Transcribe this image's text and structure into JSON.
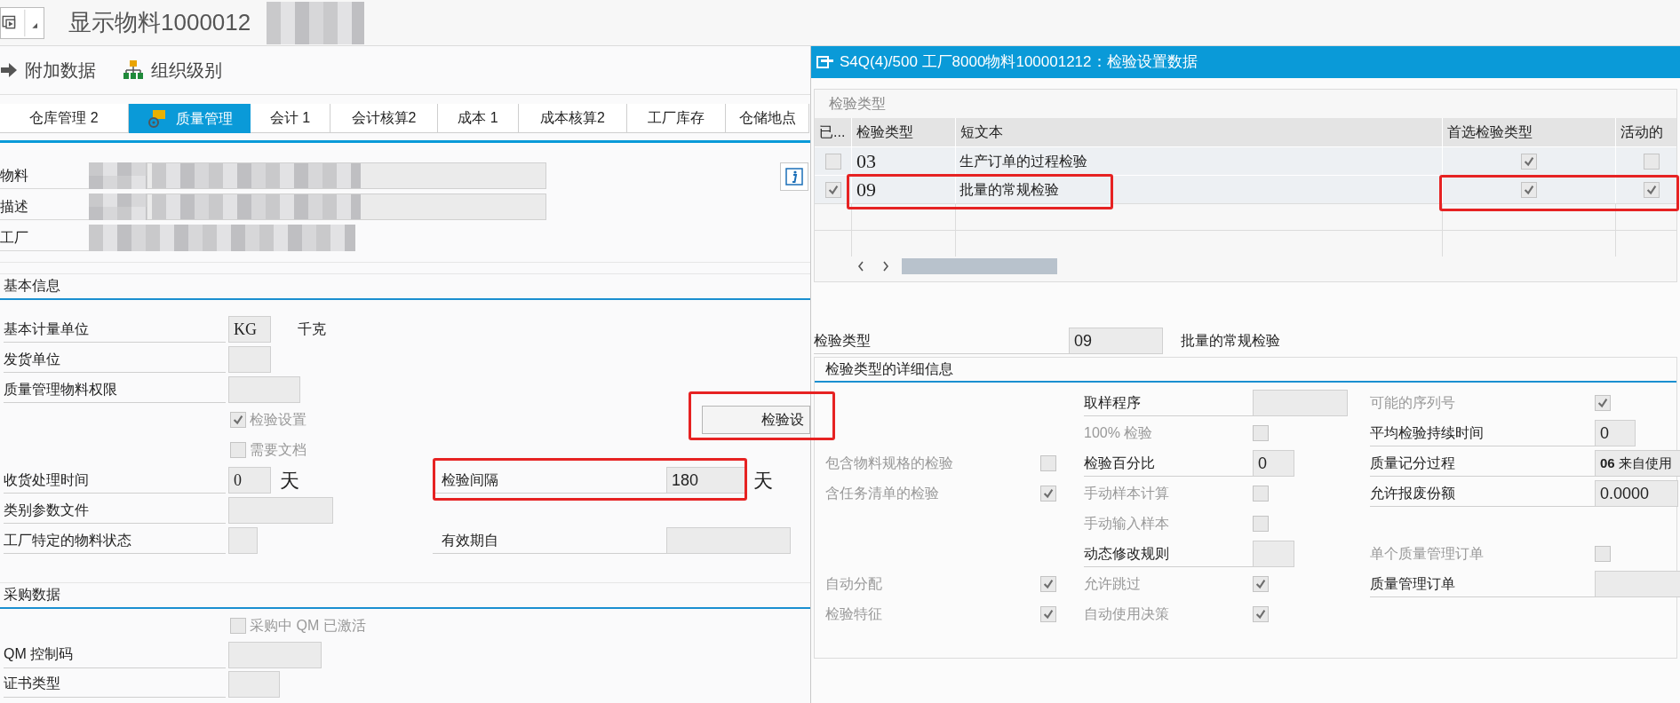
{
  "title_bar": {
    "title": "显示物料1000012"
  },
  "toolbar": [
    "附加数据",
    "组织级别"
  ],
  "tabs": [
    {
      "label": "仓库管理 2",
      "selected": false
    },
    {
      "label": "质量管理",
      "selected": true
    },
    {
      "label": "会计 1",
      "selected": false
    },
    {
      "label": "会计核算2",
      "selected": false
    },
    {
      "label": "成本 1",
      "selected": false
    },
    {
      "label": "成本核算2",
      "selected": false
    },
    {
      "label": "工厂库存",
      "selected": false
    },
    {
      "label": "仓储地点",
      "selected": false
    }
  ],
  "header_fields": [
    {
      "label": "物料"
    },
    {
      "label": "描述"
    },
    {
      "label": "工厂"
    }
  ],
  "basic_info": {
    "title": "基本信息",
    "rows": [
      {
        "kind": "field",
        "label": "基本计量单位",
        "value": "KG",
        "unit": "千克"
      },
      {
        "kind": "field",
        "label": "发货单位"
      },
      {
        "kind": "field",
        "label": "质量管理物料权限"
      },
      {
        "kind": "checkbox",
        "label": "检验设置",
        "checked": true,
        "button": "检验设"
      },
      {
        "kind": "checkbox",
        "label": "需要文档",
        "checked": false
      },
      {
        "kind": "field",
        "label": "收货处理时间",
        "value": "0",
        "unit": "天",
        "right": {
          "label": "检验间隔",
          "value": "180",
          "unit": "天"
        }
      },
      {
        "kind": "field",
        "label": "类别参数文件"
      },
      {
        "kind": "field",
        "label": "工厂特定的物料状态",
        "right": {
          "label": "有效期自"
        }
      }
    ]
  },
  "purchasing": {
    "title": "采购数据",
    "rows": [
      {
        "kind": "checkbox",
        "label": "采购中 QM 已激活",
        "checked": false
      },
      {
        "kind": "field",
        "label": "QM 控制码"
      },
      {
        "kind": "field",
        "label": "证书类型"
      }
    ]
  },
  "dialog": {
    "title": "S4Q(4)/500 工厂8000物料100001212：检验设置数据",
    "group_title": "检验类型",
    "table": {
      "columns": [
        "已...",
        "检验类型",
        "短文本",
        "首选检验类型",
        "活动的"
      ],
      "rows": [
        {
          "column_1_checked": false,
          "type": "03",
          "text": "生产订单的过程检验",
          "preferred": true,
          "active": false
        },
        {
          "column_1_checked": true,
          "type": "09",
          "text": "批量的常规检验",
          "preferred": true,
          "active": true
        }
      ]
    },
    "type_field": {
      "label": "检验类型",
      "value": "09",
      "text": "批量的常规检验"
    },
    "details_title": "检验类型的详细信息",
    "details": [
      {
        "column_2": {
          "kind": "field",
          "label": "取样程序"
        },
        "column_3": {
          "kind": "checkbox",
          "label": "可能的序列号",
          "checked": true
        }
      },
      {
        "column_2": {
          "kind": "checkbox",
          "label": "100% 检验",
          "checked": false
        },
        "column_3": {
          "kind": "field",
          "label": "平均检验持续时间",
          "value": "0"
        }
      },
      {
        "column_1": {
          "kind": "checkbox",
          "label": "包含物料规格的检验",
          "checked": false
        },
        "column_2": {
          "kind": "field",
          "label": "检验百分比",
          "value": "0"
        },
        "column_3": {
          "kind": "field",
          "label": "质量记分过程",
          "value": "**06** 来自使用"
        }
      },
      {
        "column_1": {
          "kind": "checkbox",
          "label": "含任务清单的检验",
          "checked": true
        },
        "column_2": {
          "kind": "checkbox",
          "label": "手动样本计算",
          "checked": false
        },
        "column_3": {
          "kind": "field",
          "label": "允许报废份额",
          "value": "0.0000"
        }
      },
      {
        "column_2": {
          "kind": "checkbox",
          "label": "手动输入样本",
          "checked": false
        }
      },
      {
        "column_2": {
          "kind": "field",
          "label": "动态修改规则"
        },
        "column_3": {
          "kind": "checkbox",
          "label": "单个质量管理订单",
          "checked": false
        }
      },
      {
        "column_1": {
          "kind": "checkbox",
          "label": "自动分配",
          "checked": true
        },
        "column_2": {
          "kind": "checkbox",
          "label": "允许跳过",
          "checked": true
        },
        "column_3": {
          "kind": "field",
          "label": "质量管理订单"
        }
      },
      {
        "column_1": {
          "kind": "checkbox",
          "label": "检验特征",
          "checked": true
        },
        "column_2": {
          "kind": "checkbox",
          "label": "自动使用决策",
          "checked": true
        }
      }
    ]
  }
}
